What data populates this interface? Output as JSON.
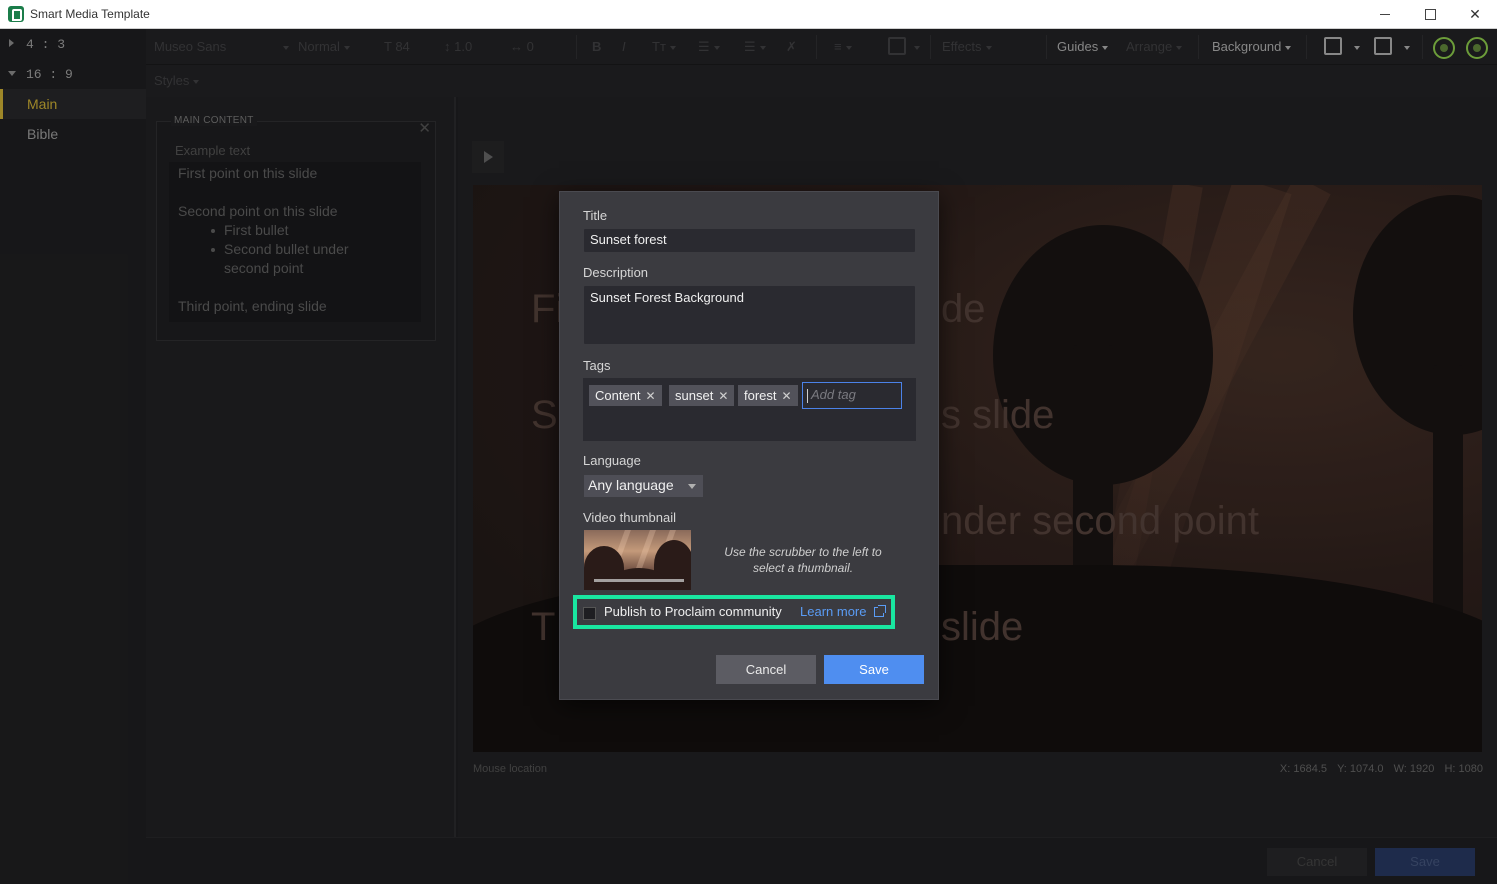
{
  "window": {
    "title": "Smart Media Template"
  },
  "sidebar": {
    "ratios": [
      {
        "label": "4 : 3",
        "expanded": false
      },
      {
        "label": "16 : 9",
        "expanded": true
      }
    ],
    "items": [
      {
        "label": "Main",
        "active": true
      },
      {
        "label": "Bible",
        "active": false
      }
    ]
  },
  "toolbar": {
    "font": "Museo Sans",
    "weight": "Normal",
    "size": "84",
    "line_height": "1.0",
    "spacing": "0",
    "effects": "Effects",
    "guides": "Guides",
    "arrange": "Arrange",
    "background": "Background",
    "styles": "Styles"
  },
  "content_panel": {
    "legend": "MAIN CONTENT",
    "placeholder": "Example text",
    "lines": {
      "point1": "First point on this slide",
      "point2": "Second point on this slide",
      "bullet1": "First bullet",
      "bullet2a": "Second bullet under",
      "bullet2b": "second point",
      "point3": "Third point, ending slide"
    }
  },
  "preview": {
    "line1_left": "Fi",
    "line1_right": "de",
    "line2_left": "S",
    "line2_right": "s slide",
    "line3_right": "nder second point",
    "line4_left": "T",
    "line4_right": "slide"
  },
  "status": {
    "mouse_location": "Mouse location",
    "x": "X: 1684.5",
    "y": "Y: 1074.0",
    "w": "W: 1920",
    "h": "H: 1080"
  },
  "bottom": {
    "cancel": "Cancel",
    "save": "Save"
  },
  "dialog": {
    "title_label": "Title",
    "title_value": "Sunset forest",
    "description_label": "Description",
    "description_value": "Sunset Forest Background",
    "tags_label": "Tags",
    "tags": [
      "Content",
      "sunset",
      "forest"
    ],
    "tag_placeholder": "Add tag",
    "language_label": "Language",
    "language_value": "Any language",
    "thumbnail_label": "Video thumbnail",
    "thumbnail_hint": "Use the scrubber to the left to select a thumbnail.",
    "publish_label": "Publish to Proclaim community",
    "publish_checked": false,
    "learn_more": "Learn more",
    "cancel": "Cancel",
    "save": "Save",
    "accent": "#4f8ef0",
    "highlight": "#19e6a0"
  }
}
